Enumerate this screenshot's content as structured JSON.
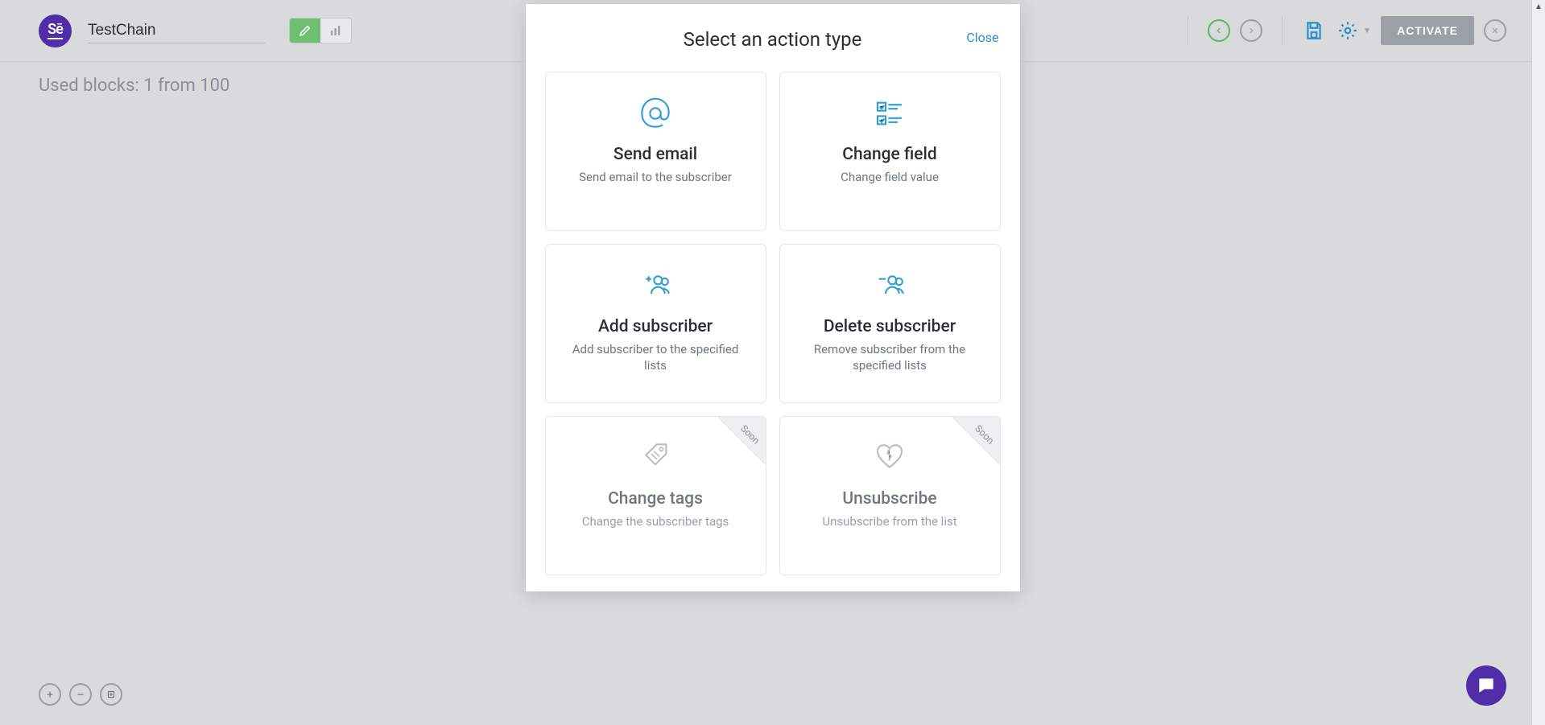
{
  "header": {
    "logo_text": "Sē",
    "chain_name": "TestChain",
    "activate_label": "ACTIVATE"
  },
  "status": {
    "used_blocks": "Used blocks: 1 from 100"
  },
  "modal": {
    "title": "Select an action type",
    "close_label": "Close",
    "soon_label": "Soon",
    "cards": [
      {
        "title": "Send email",
        "desc": "Send email to the subscriber"
      },
      {
        "title": "Change field",
        "desc": "Change field value"
      },
      {
        "title": "Add subscriber",
        "desc": "Add subscriber to the specified lists"
      },
      {
        "title": "Delete subscriber",
        "desc": "Remove subscriber from the specified lists"
      },
      {
        "title": "Change tags",
        "desc": "Change the subscriber tags"
      },
      {
        "title": "Unsubscribe",
        "desc": "Unsubscribe from the list"
      }
    ]
  }
}
